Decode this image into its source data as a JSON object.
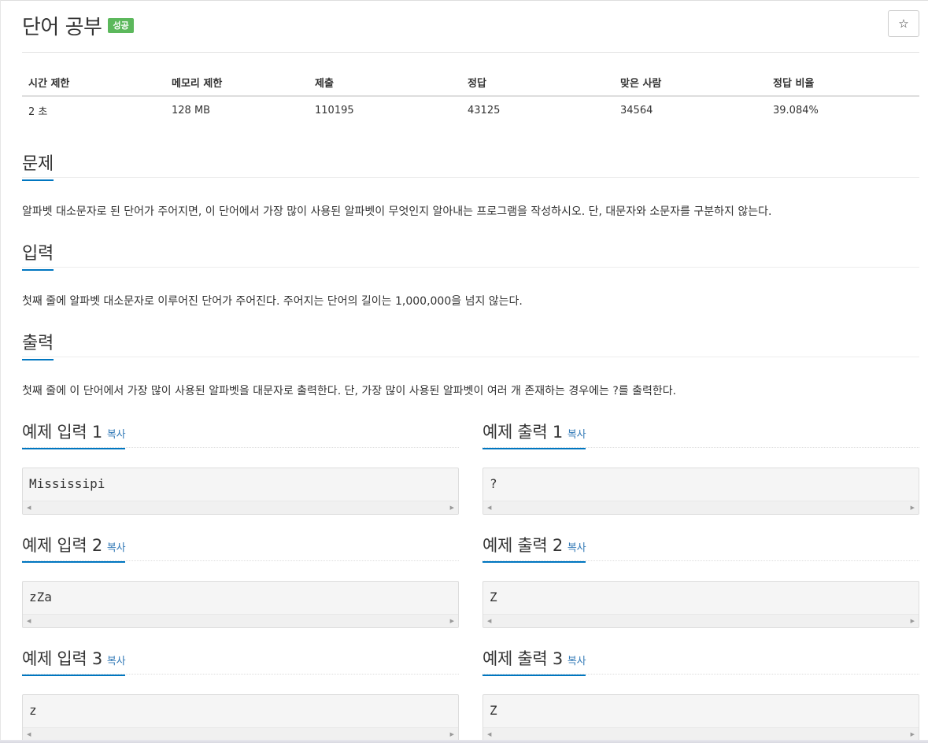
{
  "problem": {
    "title": "단어 공부",
    "status_badge": "성공",
    "star_icon": "☆"
  },
  "info_table": {
    "headers": [
      "시간 제한",
      "메모리 제한",
      "제출",
      "정답",
      "맞은 사람",
      "정답 비율"
    ],
    "values": [
      "2 초",
      "128 MB",
      "110195",
      "43125",
      "34564",
      "39.084%"
    ]
  },
  "sections": {
    "description": {
      "heading": "문제",
      "text": "알파벳 대소문자로 된 단어가 주어지면, 이 단어에서 가장 많이 사용된 알파벳이 무엇인지 알아내는 프로그램을 작성하시오. 단, 대문자와 소문자를 구분하지 않는다."
    },
    "input": {
      "heading": "입력",
      "text": "첫째 줄에 알파벳 대소문자로 이루어진 단어가 주어진다. 주어지는 단어의 길이는 1,000,000을 넘지 않는다."
    },
    "output": {
      "heading": "출력",
      "text": "첫째 줄에 이 단어에서 가장 많이 사용된 알파벳을 대문자로 출력한다. 단, 가장 많이 사용된 알파벳이 여러 개 존재하는 경우에는 ?를 출력한다."
    }
  },
  "examples": {
    "copy_label": "복사",
    "items": [
      {
        "input_title": "예제 입력 1",
        "input_value": "Mississipi",
        "output_title": "예제 출력 1",
        "output_value": "?"
      },
      {
        "input_title": "예제 입력 2",
        "input_value": "zZa",
        "output_title": "예제 출력 2",
        "output_value": "Z"
      },
      {
        "input_title": "예제 입력 3",
        "input_value": "z",
        "output_title": "예제 출력 3",
        "output_value": "Z"
      }
    ]
  },
  "colors": {
    "accent": "#0076c0",
    "badge_success": "#5cb85c",
    "link": "#337ab7"
  }
}
